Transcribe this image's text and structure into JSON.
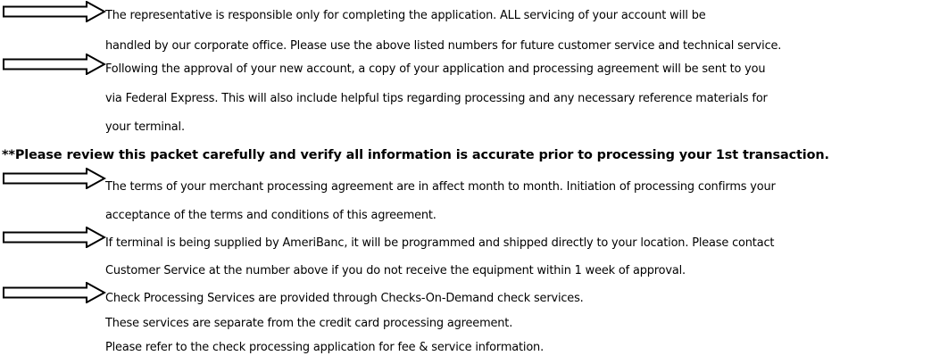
{
  "notice_items": [
    {
      "icon": "arrow-right-icon",
      "lines": [
        "The representative is responsible only for completing the application. ALL servicing of your account will be",
        "handled by our corporate office. Please use the above listed numbers for future customer service and technical service."
      ]
    },
    {
      "icon": "arrow-right-icon",
      "lines": [
        "Following the approval of your new account, a copy of your application and processing agreement will be sent to you",
        "via Federal Express. This will also include helpful tips regarding processing and any necessary reference materials for",
        "your terminal."
      ]
    },
    {
      "icon": "arrow-right-icon",
      "lines": [
        "The terms of your merchant processing agreement are in affect month to month. Initiation of processing confirms your",
        "acceptance of the terms and conditions of this agreement."
      ]
    },
    {
      "icon": "arrow-right-icon",
      "lines": [
        "If terminal is being supplied by AmeriBanc, it will be programmed and shipped directly to your location. Please contact",
        "Customer Service at the number above if you do not receive the equipment within 1 week of approval."
      ]
    },
    {
      "icon": "arrow-right-icon",
      "lines": [
        "Check Processing Services are provided through Checks-On-Demand check services.",
        "These services are separate from the credit card processing agreement.",
        "Please refer to the check processing application for fee & service information."
      ]
    }
  ],
  "review_notice": "**Please review this packet carefully and verify all information is accurate prior to processing your 1st transaction."
}
